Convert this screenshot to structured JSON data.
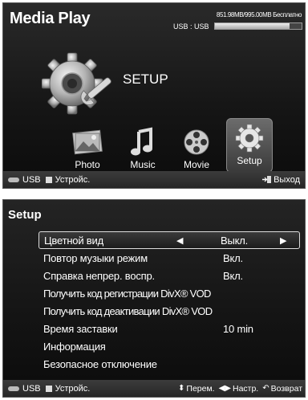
{
  "media_play": {
    "title": "Media Play",
    "storage_text": "851.98MB/995.00MB Бесплатно",
    "device_label": "USB : USB",
    "storage_used_fraction": 0.86,
    "current_label": "SETUP",
    "categories": [
      {
        "label": "Photo",
        "icon": "photo-icon"
      },
      {
        "label": "Music",
        "icon": "music-note-icon"
      },
      {
        "label": "Movie",
        "icon": "film-reel-icon"
      },
      {
        "label": "Setup",
        "icon": "gear-icon",
        "selected": true
      }
    ],
    "footer": {
      "usb_label": "USB",
      "device_label": "Устройс.",
      "exit_label": "Выход"
    }
  },
  "setup": {
    "title": "Setup",
    "items": [
      {
        "label": "Цветной вид",
        "value": "Выкл.",
        "selected": true
      },
      {
        "label": "Повтор музыки режим",
        "value": "Вкл."
      },
      {
        "label": "Справка непрер. воспр.",
        "value": "Вкл."
      },
      {
        "label": "Получить код регистрации DivX® VOD",
        "value": ""
      },
      {
        "label": "Получить код деактивации DivX® VOD",
        "value": ""
      },
      {
        "label": "Время заставки",
        "value": "10 min"
      },
      {
        "label": "Информация",
        "value": ""
      },
      {
        "label": "Безопасное отключение",
        "value": ""
      }
    ],
    "footer": {
      "usb_label": "USB",
      "device_label": "Устройс.",
      "move_label": "Перем.",
      "adjust_label": "Настр.",
      "return_label": "Возврат"
    }
  },
  "colors": {
    "panel_bg": "#161616",
    "text": "#ffffff",
    "selection_border": "#dddddd"
  }
}
